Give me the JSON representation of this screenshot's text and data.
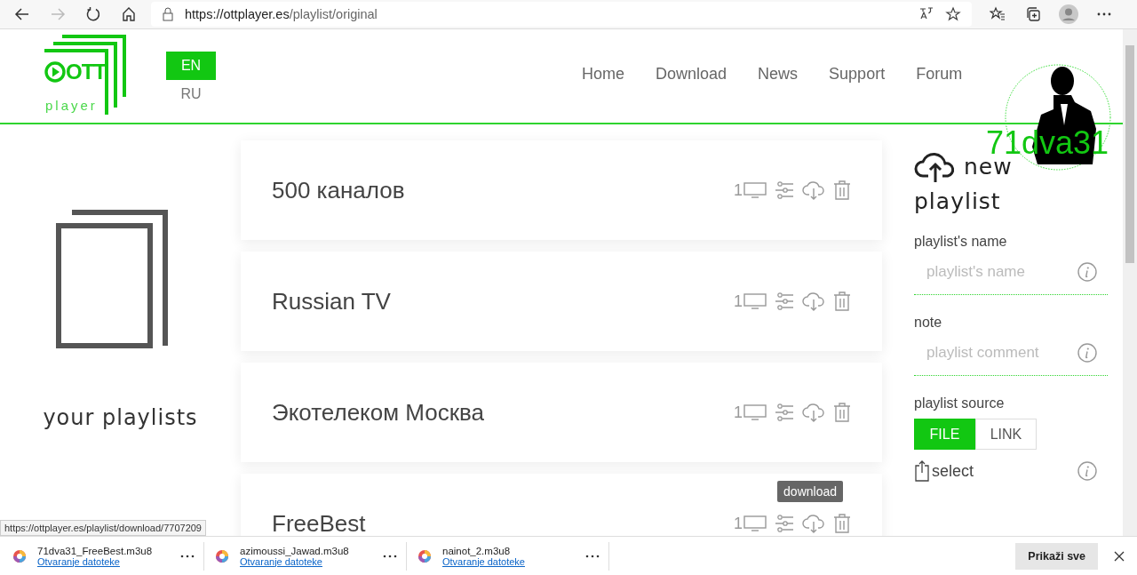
{
  "browser": {
    "url_host": "https://ottplayer.es",
    "url_path": "/playlist/original"
  },
  "logo": {
    "brand": "OTT",
    "sub": "player"
  },
  "languages": [
    {
      "label": "EN",
      "selected": true
    },
    {
      "label": "RU",
      "selected": false
    }
  ],
  "nav": [
    "Home",
    "Download",
    "News",
    "Support",
    "Forum"
  ],
  "user": {
    "name": "71dva31"
  },
  "sidebar": {
    "title": "your playlists"
  },
  "playlists": [
    {
      "name": "500 каналов",
      "count": "1"
    },
    {
      "name": "Russian TV",
      "count": "1"
    },
    {
      "name": "Экотелеком Москва",
      "count": "1"
    },
    {
      "name": "FreeBest",
      "count": "1"
    }
  ],
  "tooltip": "download",
  "new_playlist": {
    "title_1": "new",
    "title_2": "playlist",
    "name_label": "playlist's name",
    "name_placeholder": "playlist's name",
    "note_label": "note",
    "note_placeholder": "playlist comment",
    "source_label": "playlist source",
    "sources": [
      {
        "label": "FILE",
        "selected": true
      },
      {
        "label": "LINK",
        "selected": false
      }
    ],
    "select": "select"
  },
  "status_url": "https://ottplayer.es/playlist/download/7707209",
  "downloads": [
    {
      "file": "71dva31_FreeBest.m3u8",
      "action": "Otvaranje datoteke"
    },
    {
      "file": "azimoussi_Jawad.m3u8",
      "action": "Otvaranje datoteke"
    },
    {
      "file": "nainot_2.m3u8",
      "action": "Otvaranje datoteke"
    }
  ],
  "show_all": "Prikaži sve"
}
